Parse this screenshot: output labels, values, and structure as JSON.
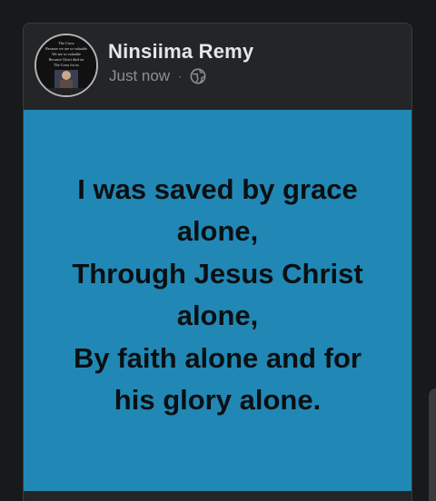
{
  "post": {
    "author_name": "Ninsiima Remy",
    "timestamp": "Just now",
    "separator": "·",
    "privacy_icon": "globe-icon",
    "body_lines": [
      "I was saved by grace",
      "alone,",
      "Through Jesus Christ",
      "alone,",
      "By faith alone and for",
      "his glory alone."
    ],
    "avatar_text": [
      "The Cross",
      "Because we are so valuable",
      "We are so valuable",
      "Because Christ died on",
      "The Cross for us"
    ]
  },
  "colors": {
    "background": "#18191a",
    "card": "#242526",
    "post_body_bg": "#2188b5",
    "post_text": "#0b0f12",
    "name_text": "#e4e6eb",
    "meta_text": "#8d9096"
  }
}
